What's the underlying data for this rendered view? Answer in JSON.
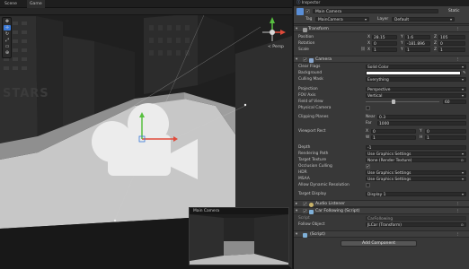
{
  "scene_tabs": {
    "scene": "Scene",
    "game": "Game"
  },
  "scene_tools": [
    "✥",
    "✛",
    "↻",
    "⤢",
    "▭",
    "⊕"
  ],
  "gizmo": {
    "persp": "< Persp"
  },
  "preview": {
    "title": "Main Camera"
  },
  "inspector": {
    "tab": "Inspector",
    "object_name": "Main Camera",
    "static_label": "Static",
    "tag_label": "Tag",
    "tag_value": "MainCamera",
    "layer_label": "Layer",
    "layer_value": "Default"
  },
  "transform": {
    "title": "Transform",
    "position": {
      "label": "Position",
      "x": "28.15",
      "y": "1.6",
      "z": "105"
    },
    "rotation": {
      "label": "Rotation",
      "x": "0",
      "y": "-181.896",
      "z": "0"
    },
    "scale": {
      "label": "Scale",
      "x": "1",
      "y": "1",
      "z": "1"
    },
    "axis": {
      "x": "X",
      "y": "Y",
      "z": "Z"
    }
  },
  "camera": {
    "title": "Camera",
    "rows": [
      {
        "label": "Clear Flags",
        "value": "Solid Color"
      },
      {
        "label": "Background",
        "value": ""
      },
      {
        "label": "Culling Mask",
        "value": "Everything"
      },
      {
        "label": "Projection",
        "value": "Perspective"
      },
      {
        "label": "FOV Axis",
        "value": "Vertical"
      },
      {
        "label": "Field of View",
        "value": "60"
      },
      {
        "label": "Physical Camera",
        "value": ""
      },
      {
        "label": "Clipping Planes",
        "value": ""
      },
      {
        "label": "Viewport Rect",
        "value": ""
      },
      {
        "label": "Depth",
        "value": "-1"
      },
      {
        "label": "Rendering Path",
        "value": "Use Graphics Settings"
      },
      {
        "label": "Target Texture",
        "value": "None (Render Texture)"
      },
      {
        "label": "Occlusion Culling",
        "value": "✔"
      },
      {
        "label": "HDR",
        "value": "Use Graphics Settings"
      },
      {
        "label": "MSAA",
        "value": "Use Graphics Settings"
      },
      {
        "label": "Allow Dynamic Resolution",
        "value": ""
      },
      {
        "label": "Target Display",
        "value": "Display 1"
      }
    ],
    "near_label": "Near",
    "near_value": "0.3",
    "far_label": "Far",
    "far_value": "1000",
    "vp": {
      "x_label": "X",
      "x": "0",
      "y_label": "Y",
      "y": "0",
      "w_label": "W",
      "w": "1",
      "h_label": "H",
      "h": "1"
    }
  },
  "audio_listener": {
    "title": "Audio Listener"
  },
  "car_following": {
    "title": "Car Following (Script)",
    "script_label": "Script",
    "script_value": "CarFollowing",
    "follow_label": "Follow Object",
    "follow_value": "JLCar (Transform)"
  },
  "missing_script": {
    "title": "(Script)"
  },
  "add_component": "Add Component",
  "colors": {
    "background_swatch": "#ffffff",
    "accent_blue": "#3a79d8"
  }
}
